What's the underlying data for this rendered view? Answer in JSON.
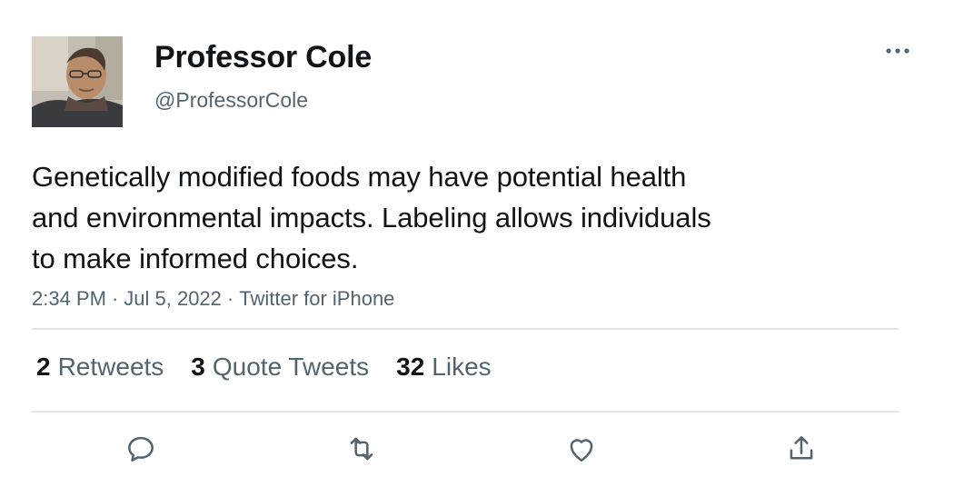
{
  "author": {
    "display_name": "Professor Cole",
    "handle": "@ProfessorCole",
    "avatar_icon": "profile-photo"
  },
  "tweet": {
    "lines": [
      "Genetically modified foods may have potential health",
      "and environmental impacts. Labeling allows individuals",
      "to make informed choices."
    ],
    "time": "2:34 PM",
    "date": "Jul 5, 2022",
    "source": "Twitter for iPhone",
    "separator": "·"
  },
  "stats": {
    "retweets_count": "2",
    "retweets_label": "Retweets",
    "quote_tweets_count": "3",
    "quote_tweets_label": "Quote Tweets",
    "likes_count": "32",
    "likes_label": "Likes"
  },
  "actions": {
    "reply_icon": "reply-icon",
    "retweet_icon": "retweet-icon",
    "like_icon": "like-icon",
    "share_icon": "share-icon",
    "more_icon": "more-icon"
  },
  "colors": {
    "text": "#0f1419",
    "secondary": "#536471",
    "divider": "#e1e5e8",
    "icon": "#536471"
  }
}
